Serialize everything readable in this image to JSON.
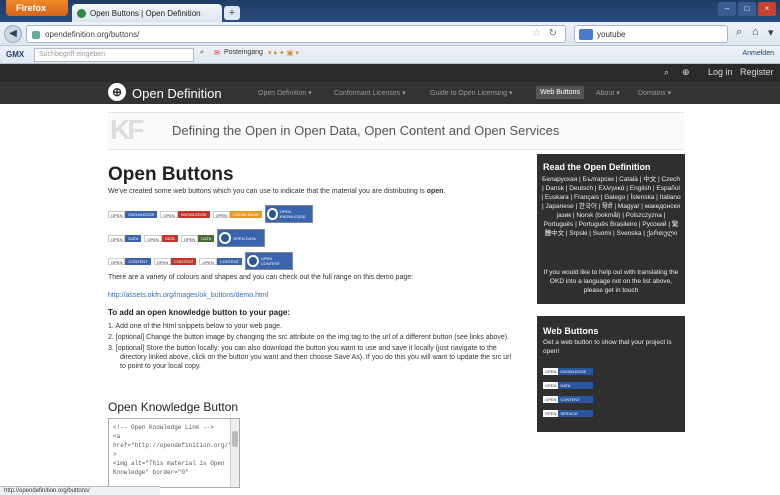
{
  "browser": {
    "firefox_label": "Firefox",
    "tab_title": "Open Buttons | Open Definition",
    "new_tab": "+",
    "url": "opendefinition.org/buttons/",
    "search_value": "youtube",
    "status_url": "http://opendefinition.org/buttons/"
  },
  "bookmarks": {
    "gmx": "GMX",
    "gmx_placeholder": "Suchbegriff eingeben",
    "postausgang": "Posteingang",
    "anmelden": "Anmelden"
  },
  "site": {
    "login": "Log in",
    "register": "Register",
    "brand": "Open Definition",
    "menu": [
      "Open Definition ▾",
      "Conformant Licenses ▾",
      "Guide to Open Licensing ▾",
      "Web Buttons",
      "About ▾",
      "Domains ▾"
    ],
    "active_menu_index": 3,
    "tagline": "Defining the Open in Open Data, Open Content and Open Services"
  },
  "content": {
    "title": "Open Buttons",
    "intro_prefix": "We've created some web buttons which you can use to indicate that the material you are distributing is ",
    "intro_strong": "open",
    "intro_suffix": ".",
    "variety": "There are a variety of colours and shapes and you can check out the full range on this demo page:",
    "demo_link": "http://assets.okfn.org/images/ok_buttons/demo.html",
    "add_heading": "To add an open knowledge button to your page:",
    "steps": [
      "1.  Add one of the html snippets below to your web page.",
      "2.  [optional] Change the button image by changing the src attribute on the img tag to the url of a different button (see links above).",
      "3.  [optional] Store the button locally: you can also download the button you want to use and save it locally (just navigate to the directory linked above, click on the button you want and then choose Save As). If you do this you will want to update the src url to point to your local copy."
    ],
    "ok_button_heading": "Open Knowledge Button",
    "code_snippet": "<!-- Open Knowledge Link -->\n<a\nhref=\"http://opendefinition.org/\"\n>\n<img alt=\"This material is Open\nKnowledge\" border=\"0\""
  },
  "buttons": {
    "rows": [
      {
        "label": "KNOWLEDGE",
        "colors": [
          "#3b64b0",
          "#c2342a",
          "#e39a2a"
        ]
      },
      {
        "label": "DATA",
        "colors": [
          "#3b64b0",
          "#c2342a",
          "#4a6a3a"
        ]
      },
      {
        "label": "CONTENT",
        "colors": [
          "#3b64b0",
          "#c2342a",
          "#3b64b0"
        ]
      }
    ],
    "open_word": "OPEN"
  },
  "sidebar": {
    "read_heading": "Read the Open Definition",
    "languages": "Беларуская | Български | Català | 中文 | Czech | Dansk | Deutsch | Ελληνικά | English | Español | Euskara | Français | Galego | Íslenska | Italiano | Japanese | 한국어 | हिंदी | Magyar | македонски јазик | Norsk (bokmål) | Polszczyzna | Português | Português Brasileiro | Русский | 繁體中文 | Srpski | Suomi | Svenska | ქართული",
    "help": "If you would like to help out with translating the OKD into a language not on the list above, please get in touch",
    "web_heading": "Web Buttons",
    "web_desc": "Get a web button to show that your project is open!",
    "web_buttons": [
      "KNOWLEDGE",
      "DATA",
      "CONTENT",
      "SERVICE"
    ]
  }
}
